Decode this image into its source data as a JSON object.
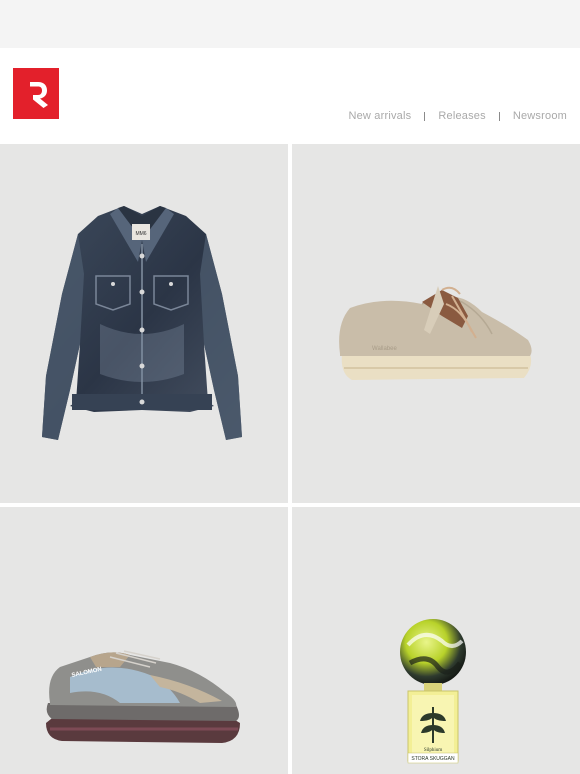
{
  "brand": {
    "logo_icon": "r-arrow-logo-icon",
    "accent_color": "#e3202b"
  },
  "nav": {
    "items": [
      {
        "label": "New arrivals"
      },
      {
        "label": "Releases"
      },
      {
        "label": "Newsroom"
      }
    ]
  },
  "products": [
    {
      "icon": "denim-jacket-icon",
      "background": "#e6e6e5"
    },
    {
      "icon": "suede-moccasin-shoe-icon",
      "background": "#e6e6e5"
    },
    {
      "icon": "trail-running-sneaker-icon",
      "background": "#e6e6e5"
    },
    {
      "icon": "perfume-bottle-icon",
      "background": "#e6e6e5"
    }
  ],
  "product_text": {
    "jacket_tag": "MM6",
    "shoe_brand": "Wallabee",
    "sneaker_brand": "SALOMON",
    "perfume_name": "Silphium",
    "perfume_brand": "STORA SKUGGAN"
  }
}
